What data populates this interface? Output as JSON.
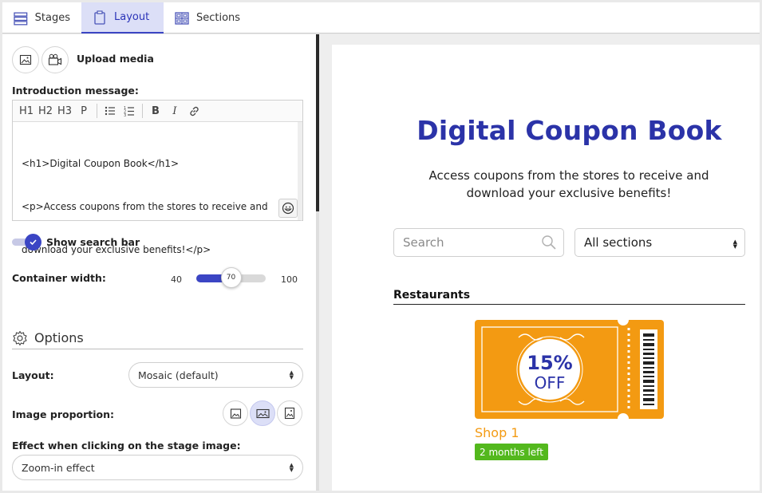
{
  "tabs": [
    {
      "label": "Stages",
      "icon": "stages-icon"
    },
    {
      "label": "Layout",
      "icon": "layout-icon",
      "active": true
    },
    {
      "label": "Sections",
      "icon": "sections-icon"
    }
  ],
  "media": {
    "upload_label": "Upload media"
  },
  "intro": {
    "label": "Introduction message:",
    "toolbar": [
      "H1",
      "H2",
      "H3",
      "P"
    ],
    "lines": [
      "<h1>Digital Coupon Book</h1>",
      "<p>Access coupons from the stores to receive and",
      "download your exclusive benefits!</p>"
    ]
  },
  "search_toggle": {
    "label": "Show search bar",
    "on": true
  },
  "container_width": {
    "label": "Container width:",
    "min": "40",
    "max": "100",
    "value": 70,
    "value_text": "70"
  },
  "options": {
    "title": "Options",
    "layout_label": "Layout:",
    "layout_value": "Mosaic (default)",
    "image_proportion_label": "Image proportion:",
    "effect_label": "Effect when clicking on the stage image:",
    "effect_value": "Zoom-in effect"
  },
  "preview": {
    "title": "Digital Coupon Book",
    "intro_line1": "Access coupons from the stores to receive and",
    "intro_line2": "download your exclusive benefits!",
    "search_placeholder": "Search",
    "section_select": "All sections",
    "section_heading": "Restaurants",
    "coupon": {
      "big": "15%",
      "small": "OFF",
      "color": "#f39a12",
      "accent": "#2b33a8"
    },
    "shop_name": "Shop 1",
    "badge": "2 months left"
  },
  "colors": {
    "accent": "#3b45c4",
    "tab_active_bg": "#dcdff7",
    "badge": "#53b81d"
  }
}
